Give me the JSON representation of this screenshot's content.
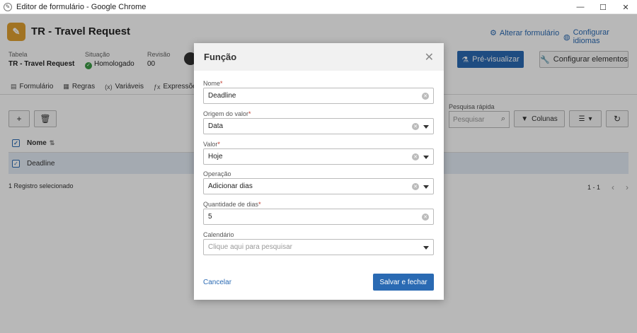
{
  "window": {
    "title": "Editor de formulário - Google Chrome"
  },
  "header": {
    "form_title": "TR - Travel Request",
    "alter_form_link": "Alterar formulário",
    "config_lang_link": "Configurar idiomas"
  },
  "meta": {
    "table_label": "Tabela",
    "table_value": "TR - Travel Request",
    "status_label": "Situação",
    "status_value": "Homologado",
    "revision_label": "Revisão",
    "revision_value": "00"
  },
  "actions": {
    "preview_label": "Pré-visualizar",
    "config_elements_label": "Configurar elementos"
  },
  "tabs": [
    {
      "label": "Formulário",
      "icon": "form-icon"
    },
    {
      "label": "Regras",
      "icon": "rules-icon"
    },
    {
      "label": "Variáveis",
      "icon": "variables-icon"
    },
    {
      "label": "Expressões",
      "icon": "expressions-icon"
    }
  ],
  "toolbar": {
    "quick_search_label": "Pesquisa rápida",
    "search_placeholder": "Pesquisar",
    "columns_label": "Colunas"
  },
  "grid": {
    "column_name": "Nome",
    "rows": [
      {
        "name": "Deadline",
        "checked": true
      }
    ],
    "footer_selected": "1 Registro selecionado",
    "pager": "1 - 1"
  },
  "modal": {
    "title": "Função",
    "fields": {
      "nome": {
        "label": "Nome",
        "value": "Deadline"
      },
      "origem": {
        "label": "Origem do valor",
        "value": "Data"
      },
      "valor": {
        "label": "Valor",
        "value": "Hoje"
      },
      "operacao": {
        "label": "Operação",
        "value": "Adicionar dias"
      },
      "quantidade": {
        "label": "Quantidade de dias",
        "value": "5"
      },
      "calendario": {
        "label": "Calendário",
        "placeholder": "Clique aqui para pesquisar"
      }
    },
    "cancel_label": "Cancelar",
    "save_label": "Salvar e fechar"
  },
  "colors": {
    "primary": "#2a6ab3",
    "required": "#c0392b",
    "status_ok": "#3b9a45",
    "logo": "#e0a030"
  }
}
